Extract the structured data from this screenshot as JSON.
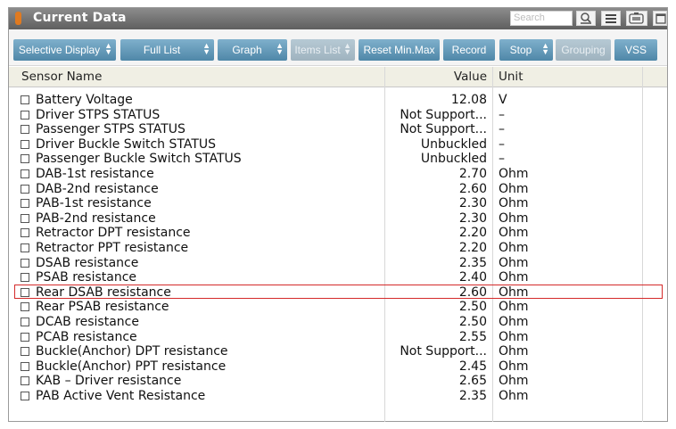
{
  "window": {
    "title": "Current Data"
  },
  "search": {
    "placeholder": "Search"
  },
  "toolbar_icons": [
    "zoom-icon",
    "list-view-icon",
    "battery-icon",
    "window-icon"
  ],
  "toolbar": {
    "selective_display": "Selective Display",
    "full_list": "Full List",
    "graph": "Graph",
    "items_list": "Items List",
    "reset_min_max": "Reset Min.Max",
    "record": "Record",
    "stop": "Stop",
    "grouping": "Grouping",
    "vss": "VSS"
  },
  "table": {
    "headers": {
      "name": "Sensor Name",
      "value": "Value",
      "unit": "Unit"
    },
    "rows": [
      {
        "name": "Battery Voltage",
        "value": "12.08",
        "unit": "V"
      },
      {
        "name": "Driver STPS STATUS",
        "value": "Not Support...",
        "unit": "–"
      },
      {
        "name": "Passenger STPS STATUS",
        "value": "Not Support...",
        "unit": "–"
      },
      {
        "name": "Driver Buckle Switch STATUS",
        "value": "Unbuckled",
        "unit": "–"
      },
      {
        "name": "Passenger Buckle Switch STATUS",
        "value": "Unbuckled",
        "unit": "–"
      },
      {
        "name": "DAB-1st resistance",
        "value": "2.70",
        "unit": "Ohm"
      },
      {
        "name": "DAB-2nd resistance",
        "value": "2.60",
        "unit": "Ohm"
      },
      {
        "name": "PAB-1st resistance",
        "value": "2.30",
        "unit": "Ohm"
      },
      {
        "name": "PAB-2nd resistance",
        "value": "2.30",
        "unit": "Ohm"
      },
      {
        "name": "Retractor DPT resistance",
        "value": "2.20",
        "unit": "Ohm"
      },
      {
        "name": "Retractor PPT resistance",
        "value": "2.20",
        "unit": "Ohm"
      },
      {
        "name": "DSAB resistance",
        "value": "2.35",
        "unit": "Ohm"
      },
      {
        "name": "PSAB resistance",
        "value": "2.40",
        "unit": "Ohm"
      },
      {
        "name": "Rear DSAB resistance",
        "value": "2.60",
        "unit": "Ohm",
        "highlighted": true
      },
      {
        "name": "Rear PSAB resistance",
        "value": "2.50",
        "unit": "Ohm"
      },
      {
        "name": "DCAB resistance",
        "value": "2.50",
        "unit": "Ohm"
      },
      {
        "name": "PCAB resistance",
        "value": "2.55",
        "unit": "Ohm"
      },
      {
        "name": "Buckle(Anchor) DPT resistance",
        "value": "Not Support...",
        "unit": "Ohm"
      },
      {
        "name": "Buckle(Anchor) PPT resistance",
        "value": "2.45",
        "unit": "Ohm"
      },
      {
        "name": "KAB – Driver resistance",
        "value": "2.65",
        "unit": "Ohm"
      },
      {
        "name": "PAB Active Vent Resistance",
        "value": "2.35",
        "unit": "Ohm"
      }
    ]
  }
}
